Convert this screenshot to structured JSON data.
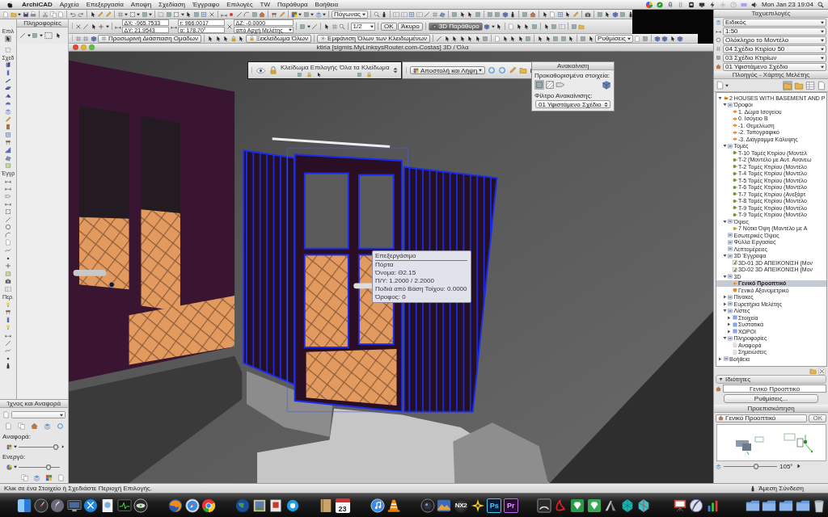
{
  "menu_bar": {
    "app_name": "ArchiCAD",
    "menus": [
      "Αρχείο",
      "Επεξεργασία",
      "Αποψη",
      "Σχεδίαση",
      "Έγγραφο",
      "Επιλογές",
      "TW",
      "Παράθυρα",
      "Βοήθεια"
    ],
    "clock": "Mon Jan 23 19:04"
  },
  "toolbar_1": {
    "dropdown": "Πόγωνας"
  },
  "info_box": {
    "title": "Πληροφορίες",
    "dx": "ΔX: -965.7533",
    "dy": "ΔY: 21.9543",
    "r": "r: 966.0017",
    "angle": "α: 178.70°",
    "dz": "ΔZ: -0.0000",
    "reference": "από Αρχή Μελέτης",
    "fraction": "1/2",
    "ok": "OK",
    "cancel": "Άκυρο",
    "window_button": "3D Παράθυρο"
  },
  "toolbar_3": {
    "buttons": [
      "Προσωρινή Διάσπαση Ομάδων",
      "Ξεκλείδωμα Όλων",
      "Εμφάνιση Όλων των Κλειδωμένων"
    ],
    "dropdown": "Ρυθμίσεις"
  },
  "toolbox": {
    "sections": [
      {
        "label": "Επιλ",
        "tools": [
          {
            "selected": true
          },
          {
            "selected": false
          }
        ]
      },
      {
        "label": "Σχεδ",
        "tools": [
          {
            "selected": false
          },
          {
            "selected": false
          },
          {
            "selected": false
          },
          {
            "selected": false
          },
          {
            "selected": false
          },
          {
            "selected": false
          },
          {
            "selected": false
          },
          {
            "selected": false
          },
          {
            "selected": false
          },
          {
            "selected": false
          },
          {
            "selected": false
          },
          {
            "selected": false
          },
          {
            "selected": false
          },
          {
            "selected": false
          }
        ]
      },
      {
        "label": "Έγγρ",
        "tools": [
          {
            "selected": false
          },
          {
            "selected": false
          },
          {
            "selected": false
          },
          {
            "selected": false
          },
          {
            "selected": false
          },
          {
            "selected": false
          },
          {
            "selected": false
          },
          {
            "selected": false
          },
          {
            "selected": false
          },
          {
            "selected": false
          },
          {
            "selected": false
          },
          {
            "selected": false
          },
          {
            "selected": false
          },
          {
            "selected": false
          },
          {
            "selected": false
          }
        ]
      },
      {
        "label": "Περ.",
        "tools": [
          {
            "selected": false
          },
          {
            "selected": false
          },
          {
            "selected": false
          },
          {
            "selected": false
          },
          {
            "selected": false
          },
          {
            "selected": false
          },
          {
            "selected": false
          },
          {
            "selected": false
          },
          {
            "selected": false
          }
        ]
      }
    ]
  },
  "trace_panel": {
    "title": "Ίχνος και Αναφορά",
    "reference_label": "Αναφορά:",
    "reference_slider": {
      "level": 0.92
    },
    "active_label": "Ενεργό:",
    "active_slider": {
      "level": 0.72
    }
  },
  "window": {
    "title": "ktiria [sigmis.MyLinksysRouter.com-Costas] 3D / Όλα"
  },
  "lock_palette": {
    "labels": [
      "Κλείδωμα Επιλογής",
      "Όλα τα Κλείδωμα"
    ]
  },
  "teamwork_palette": {
    "button": "Αποστολή και Λήψη"
  },
  "renovation_palette": {
    "title": "Ανακαίνιση",
    "presets_label": "Προκαθορισμένα στοιχεία:",
    "presets": [
      {
        "selected": true
      },
      {
        "selected": false
      },
      {
        "selected": false
      }
    ],
    "filter_label": "Φίλτρο Ανακαίνισης:",
    "filter": "01 Υφιστάμενο Σχέδιο"
  },
  "info_tooltip": {
    "lines": [
      "Επεξεργάσιμο",
      "Πόρτα",
      "Όνομα: Θ2.15",
      "Π/Υ: 1.2000 / 2.2000",
      "Ποδιά από Βάση Τοίχου: 0.0000",
      "Όροφος: 0"
    ]
  },
  "quick_options": {
    "title": "Ταχυεπιλογές",
    "dropdowns": [
      "Ειδικός",
      "1:50",
      "Ολόκληρο το Μοντέλο",
      "04 Σχέδιο Κτιρίου 50",
      "03 Σχέδιο Κτιρίων",
      "01 Υφιστάμενο Σχέδιο"
    ]
  },
  "navigator": {
    "title": "Πλοηγός - Χάρτης Μελέτης",
    "tabs": [
      {
        "selected": true
      },
      {
        "selected": false
      },
      {
        "selected": false
      },
      {
        "selected": false
      }
    ],
    "tree": [
      {
        "label": "2 HOUSES WITH BASEMENT AND P",
        "kind": "project",
        "expanded": true,
        "selected": false,
        "children": [
          {
            "label": "Όροφοι",
            "kind": "group",
            "expanded": true,
            "selected": false,
            "children": [
              {
                "label": "1. Δώμα Ισογείου",
                "kind": "story",
                "selected": false
              },
              {
                "label": "0. Ισόγειο Β",
                "kind": "story",
                "selected": false
              },
              {
                "label": "-1. Θεμελίωση",
                "kind": "story",
                "selected": false
              },
              {
                "label": "-2. Τοπογραφικό",
                "kind": "story",
                "selected": false
              },
              {
                "label": "-3. Διάγραμμα Κάλυψης",
                "kind": "story",
                "selected": false
              }
            ]
          },
          {
            "label": "Τομές",
            "kind": "group",
            "expanded": true,
            "selected": false,
            "children": [
              {
                "label": "T-10 Τομές Κτιρίου (Μοντέλ",
                "kind": "section",
                "selected": false
              },
              {
                "label": "T-2 (Μοντέλο με Αυτ. Ανανεω",
                "kind": "section",
                "selected": false
              },
              {
                "label": "T-2 Τομές Κτιρίου (Μοντέλο",
                "kind": "section",
                "selected": false
              },
              {
                "label": "T-4 Τομές Κτιρίου (Μοντέλο",
                "kind": "section",
                "selected": false
              },
              {
                "label": "T-5 Τομές Κτιρίου (Μοντέλο",
                "kind": "section",
                "selected": false
              },
              {
                "label": "T-6 Τομές Κτιρίου (Μοντέλο",
                "kind": "section",
                "selected": false
              },
              {
                "label": "T-7 Τομές Κτιρίου (Ανεξάρτ",
                "kind": "section",
                "selected": false
              },
              {
                "label": "T-8 Τομές Κτιρίου (Μοντέλο",
                "kind": "section",
                "selected": false
              },
              {
                "label": "T-9 Τομές Κτιρίου (Μοντέλο",
                "kind": "section",
                "selected": false
              },
              {
                "label": "T-9 Τομές Κτιρίου (Μοντέλο",
                "kind": "section",
                "selected": false
              }
            ]
          },
          {
            "label": "Όψεις",
            "kind": "group",
            "expanded": true,
            "selected": false,
            "children": [
              {
                "label": "7 Νότια Όψη (Μοντέλο με Α",
                "kind": "elevation",
                "selected": false
              }
            ]
          },
          {
            "label": "Εσωτερικές Όψεις",
            "kind": "group",
            "selected": false
          },
          {
            "label": "Φύλλα Εργασίας",
            "kind": "group",
            "selected": false
          },
          {
            "label": "Λεπτομέρειες",
            "kind": "group",
            "selected": false
          },
          {
            "label": "3D Έγγραφα",
            "kind": "group",
            "expanded": true,
            "selected": false,
            "children": [
              {
                "label": "3D-01 3D ΑΠΕΙΚΟΝΙΣΗ (Μον",
                "kind": "document",
                "selected": false
              },
              {
                "label": "3D-02 3D ΑΠΕΙΚΟΝΙΣΗ (Μον",
                "kind": "document",
                "selected": false
              }
            ]
          },
          {
            "label": "3D",
            "kind": "group",
            "expanded": true,
            "selected": false,
            "children": [
              {
                "label": "Γενικό Προοπτικό",
                "kind": "perspective",
                "selected": true
              },
              {
                "label": "Γενικό Αξονομετρικό",
                "kind": "axonometric",
                "selected": false
              }
            ]
          },
          {
            "label": "Πίνακες",
            "kind": "group",
            "expanded": false,
            "selected": false
          },
          {
            "label": "Ευρετήρια Μελέτης",
            "kind": "group",
            "expanded": false,
            "selected": false
          },
          {
            "label": "Λίστες",
            "kind": "group",
            "expanded": true,
            "selected": false,
            "children": [
              {
                "label": "Στοιχεία",
                "kind": "list",
                "expanded": false,
                "selected": false
              },
              {
                "label": "Συστατικά",
                "kind": "list",
                "expanded": false,
                "selected": false
              },
              {
                "label": "ΧΩΡΟΙ",
                "kind": "list",
                "expanded": false,
                "selected": false
              }
            ]
          },
          {
            "label": "Πληροφορίες",
            "kind": "group",
            "expanded": true,
            "selected": false,
            "children": [
              {
                "label": "Αναφορά",
                "kind": "note",
                "selected": false
              },
              {
                "label": "Σημειώσεις",
                "kind": "note",
                "selected": false
              }
            ]
          }
        ]
      },
      {
        "label": "Βοήθεια",
        "kind": "group",
        "expanded": false,
        "selected": false
      }
    ]
  },
  "properties": {
    "title": "Ιδιότητες",
    "expanded": true,
    "name": "Γενικό Προοπτικό",
    "settings_button": "Ρυθμίσεις..."
  },
  "preview": {
    "title": "Προεπισκόπηση",
    "view": "Γενικό Προοπτικό",
    "ok": "OK",
    "angle_slider": {
      "level": 0.6
    },
    "angle": "105°"
  },
  "status_bar": {
    "message": "Κλικ σε ένα Στοιχείο ή Σχεδιάστε Περιοχή Επιλογής.",
    "connection": "Άμεση Σύνδεση"
  },
  "dock": {
    "calendar_date": "23",
    "lens_label": "NX2",
    "letter_tiles": [
      "Ps",
      "Pr"
    ]
  }
}
